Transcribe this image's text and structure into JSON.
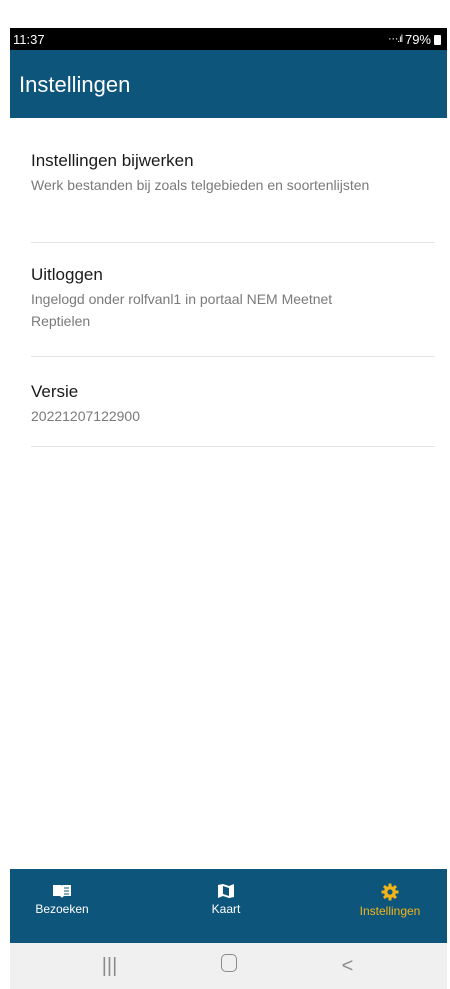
{
  "status_bar": {
    "time": "11:37",
    "signal": "⋯.ıl",
    "battery": "79%"
  },
  "header": {
    "title": "Instellingen"
  },
  "settings": [
    {
      "title": "Instellingen bijwerken",
      "description": "Werk bestanden bij zoals telgebieden en soortenlijsten"
    },
    {
      "title": "Uitloggen",
      "description": "Ingelogd onder rolfvanl1 in portaal NEM Meetnet Reptielen"
    },
    {
      "title": "Versie",
      "description": "20221207122900"
    }
  ],
  "bottom_nav": [
    {
      "label": "Bezoeken",
      "icon": "book-icon"
    },
    {
      "label": "Kaart",
      "icon": "map-icon"
    },
    {
      "label": "Instellingen",
      "icon": "gear-icon",
      "active": true
    }
  ],
  "colors": {
    "header": "#0e557c",
    "nav": "#0e557c",
    "active": "#f2b418",
    "divider": "#e4e4e4"
  },
  "android_nav": {
    "icons": [
      "recents-icon",
      "home-icon",
      "back-icon"
    ]
  }
}
